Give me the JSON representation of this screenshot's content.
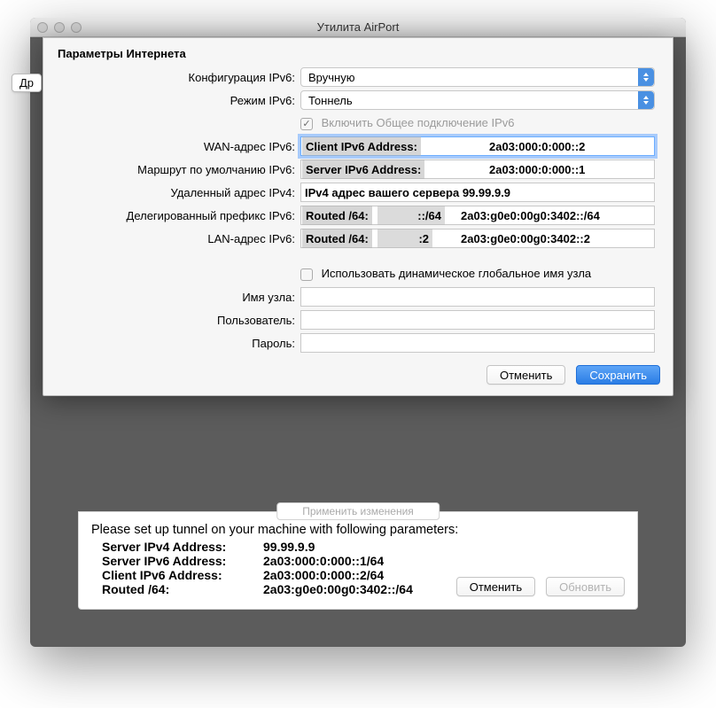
{
  "window": {
    "title": "Утилита AirPort",
    "back_btn": "Др"
  },
  "dialog": {
    "heading": "Параметры Интернета",
    "labels": {
      "config": "Конфигурация IPv6:",
      "mode": "Режим IPv6:",
      "share": "Включить Общее подключение IPv6",
      "wan": "WAN-адрес IPv6:",
      "route": "Маршрут по умолчанию IPv6:",
      "remote4": "Удаленный адрес IPv4:",
      "prefix": "Делегированный префикс IPv6:",
      "lan": "LAN-адрес IPv6:",
      "dynhost": "Использовать динамическое глобальное имя узла",
      "host": "Имя узла:",
      "user": "Пользователь:",
      "pass": "Пароль:"
    },
    "values": {
      "config": "Вручную",
      "mode": "Тоннель"
    },
    "overlays": {
      "wan_label": "Client IPv6 Address:",
      "wan_value": "2a03:000:0:000::2",
      "route_label": "Server IPv6 Address:",
      "route_value": "2a03:000:0:000::1",
      "remote4_text": "IPv4 адрес вашего сервера 99.99.9.9",
      "prefix_label": "Routed /64:",
      "prefix_mask": "::/64",
      "prefix_value": "2a03:g0e0:00g0:3402::/64",
      "lan_label": "Routed /64:",
      "lan_mask": ":2",
      "lan_value": "2a03:g0e0:00g0:3402::2"
    },
    "buttons": {
      "cancel": "Отменить",
      "save": "Сохранить"
    }
  },
  "lower": {
    "ghost": "Применить изменения",
    "head": "Please set up tunnel on your machine with following parameters:",
    "lines": [
      {
        "k": "Server IPv4 Address:",
        "v": "99.99.9.9"
      },
      {
        "k": "Server IPv6 Address:",
        "v": "2a03:000:0:000::1/64"
      },
      {
        "k": "Client IPv6 Address:",
        "v": "2a03:000:0:000::2/64"
      },
      {
        "k": "Routed /64:",
        "v": "2a03:g0e0:00g0:3402::/64"
      }
    ],
    "buttons": {
      "cancel": "Отменить",
      "update": "Обновить"
    }
  }
}
